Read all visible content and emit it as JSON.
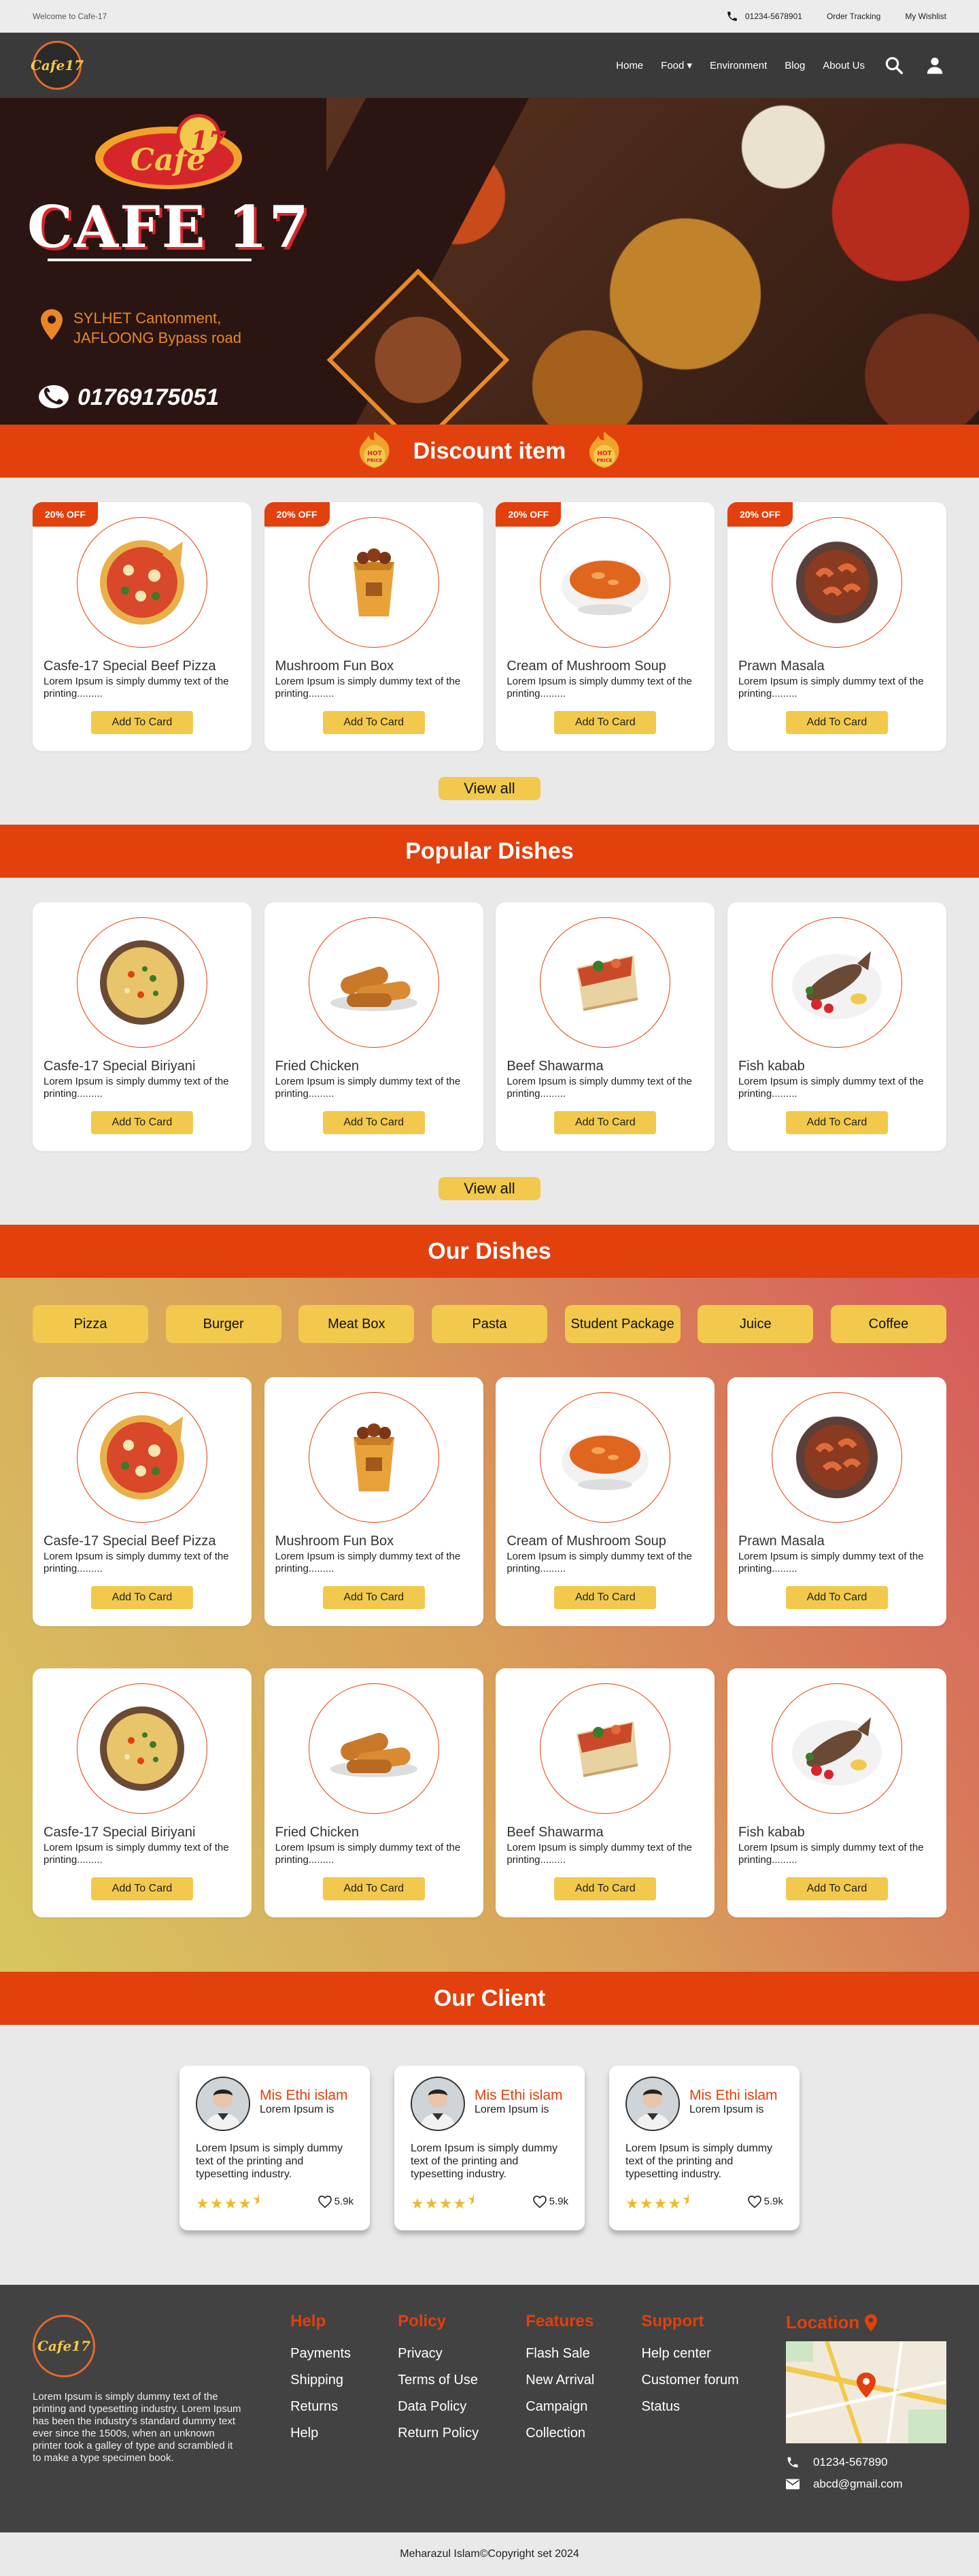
{
  "topbar": {
    "welcome": "Welcome to Cafe-17",
    "phone": "01234-5678901",
    "order_tracking": "Order Tracking",
    "wishlist": "My Wishlist"
  },
  "nav": {
    "logo_text": "Cafe17",
    "items": [
      "Home",
      "Food ▾",
      "Environment",
      "Blog",
      "About Us"
    ]
  },
  "hero": {
    "title": "CAFE 17",
    "address_line1": "SYLHET Cantonment,",
    "address_line2": "JAFLOONG Bypass road",
    "hotline": "01769175051"
  },
  "discount": {
    "heading": "Discount item",
    "badge": "HOT PRICE",
    "items": [
      {
        "tag": "20% OFF",
        "name": "Casfe-17 Special Beef Pizza",
        "desc": "Lorem Ipsum is simply dummy text of the printing.........",
        "button": "Add To Card",
        "icon": "pizza-icon"
      },
      {
        "tag": "20% OFF",
        "name": "Mushroom Fun Box",
        "desc": "Lorem Ipsum is simply dummy text of the printing.........",
        "button": "Add To Card",
        "icon": "fun-box-icon"
      },
      {
        "tag": "20% OFF",
        "name": "Cream of Mushroom Soup",
        "desc": "Lorem Ipsum is simply dummy text of the printing.........",
        "button": "Add To Card",
        "icon": "soup-icon"
      },
      {
        "tag": "20% OFF",
        "name": "Prawn Masala",
        "desc": "Lorem Ipsum is simply dummy text of the printing.........",
        "button": "Add To Card",
        "icon": "masala-icon"
      }
    ],
    "view_all": "View all"
  },
  "popular": {
    "heading": "Popular Dishes",
    "items": [
      {
        "name": "Casfe-17 Special Biriyani",
        "desc": "Lorem Ipsum is simply dummy text of the printing.........",
        "button": "Add To Card",
        "icon": "biriyani-icon"
      },
      {
        "name": "Fried Chicken",
        "desc": "Lorem Ipsum is simply dummy text of the printing.........",
        "button": "Add To Card",
        "icon": "fried-chicken-icon"
      },
      {
        "name": "Beef Shawarma",
        "desc": "Lorem Ipsum is simply dummy text of the printing.........",
        "button": "Add To Card",
        "icon": "shawarma-icon"
      },
      {
        "name": "Fish kabab",
        "desc": "Lorem Ipsum is simply dummy text of the printing.........",
        "button": "Add To Card",
        "icon": "fish-icon"
      }
    ],
    "view_all": "View all"
  },
  "our_dishes": {
    "heading": "Our Dishes",
    "filters": [
      "Pizza",
      "Burger",
      "Meat Box",
      "Pasta",
      "Student Package",
      "Juice",
      "Coffee"
    ],
    "row1": [
      {
        "name": "Casfe-17 Special Beef Pizza",
        "desc": "Lorem Ipsum is simply dummy text of the printing.........",
        "button": "Add To Card",
        "icon": "pizza-icon"
      },
      {
        "name": "Mushroom Fun Box",
        "desc": "Lorem Ipsum is simply dummy text of the printing.........",
        "button": "Add To Card",
        "icon": "fun-box-icon"
      },
      {
        "name": "Cream of Mushroom Soup",
        "desc": "Lorem Ipsum is simply dummy text of the printing.........",
        "button": "Add To Card",
        "icon": "soup-icon"
      },
      {
        "name": "Prawn Masala",
        "desc": "Lorem Ipsum is simply dummy text of the printing.........",
        "button": "Add To Card",
        "icon": "masala-icon"
      }
    ],
    "row2": [
      {
        "name": "Casfe-17 Special Biriyani",
        "desc": "Lorem Ipsum is simply dummy text of the printing.........",
        "button": "Add To Card",
        "icon": "biriyani-icon"
      },
      {
        "name": "Fried Chicken",
        "desc": "Lorem Ipsum is simply dummy text of the printing.........",
        "button": "Add To Card",
        "icon": "fried-chicken-icon"
      },
      {
        "name": "Beef Shawarma",
        "desc": "Lorem Ipsum is simply dummy text of the printing.........",
        "button": "Add To Card",
        "icon": "shawarma-icon"
      },
      {
        "name": "Fish kabab",
        "desc": "Lorem Ipsum is simply dummy text of the printing.........",
        "button": "Add To Card",
        "icon": "fish-icon"
      }
    ]
  },
  "clients": {
    "heading": "Our Client",
    "items": [
      {
        "name": "Mis Ethi islam",
        "sub": "Lorem Ipsum is",
        "text": "Lorem Ipsum is simply dummy text of the printing and typesetting industry.",
        "rating": 4.5,
        "likes": "5.9k"
      },
      {
        "name": "Mis Ethi islam",
        "sub": "Lorem Ipsum is",
        "text": "Lorem Ipsum is simply dummy text of the printing and typesetting industry.",
        "rating": 4.5,
        "likes": "5.9k"
      },
      {
        "name": "Mis Ethi islam",
        "sub": "Lorem Ipsum is",
        "text": "Lorem Ipsum is simply dummy text of the printing and typesetting industry.",
        "rating": 4.5,
        "likes": "5.9k"
      }
    ]
  },
  "footer": {
    "logo_text": "Cafe17",
    "about": "Lorem Ipsum is simply dummy text of the printing and typesetting industry. Lorem Ipsum has been the industry's standard dummy text ever since the 1500s, when an unknown printer took a galley of type and scrambled it to make a type specimen book.",
    "help": {
      "title": "Help",
      "links": [
        "Payments",
        "Shipping",
        "Returns",
        "Help"
      ]
    },
    "policy": {
      "title": "Policy",
      "links": [
        "Privacy",
        "Terms of Use",
        "Data Policy",
        "Return Policy"
      ]
    },
    "features": {
      "title": "Features",
      "links": [
        "Flash Sale",
        "New Arrival",
        "Campaign",
        "Collection"
      ]
    },
    "support": {
      "title": "Support",
      "links": [
        "Help center",
        "Customer forum",
        "Status"
      ]
    },
    "location": {
      "title": "Location",
      "phone": "01234-567890",
      "email": "abcd@gmail.com"
    }
  },
  "copyright": "Meharazul Islam©Copyright set 2024",
  "colors": {
    "accent": "#e2400c",
    "button": "#f2c94c",
    "dark": "#3a3a3a"
  }
}
